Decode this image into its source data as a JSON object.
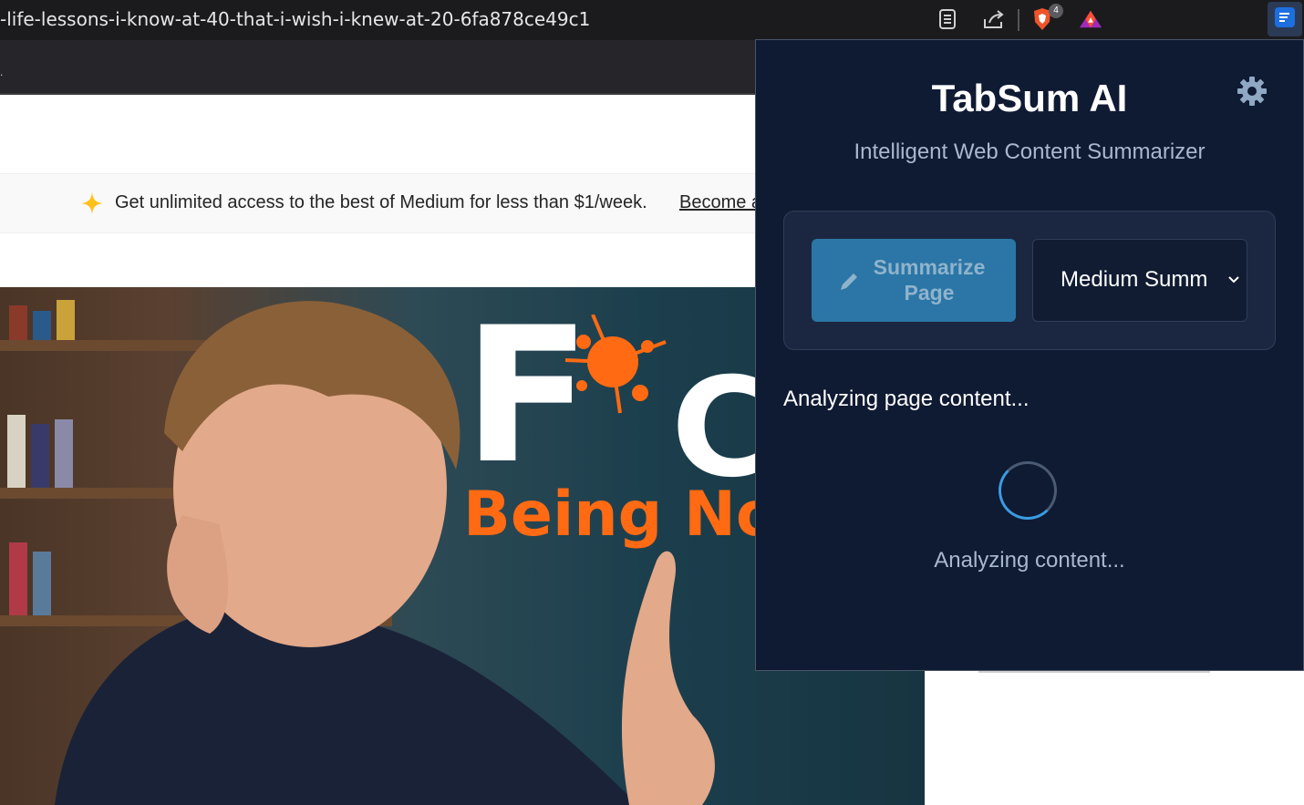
{
  "browser": {
    "url_fragment": "-life-lessons-i-know-at-40-that-i-wish-i-knew-at-20-6fa878ce49c1",
    "brave_badge_count": "4",
    "toolbar_mark": "."
  },
  "page": {
    "banner_text": "Get unlimited access to the best of Medium for less than $1/week.",
    "banner_link": "Become a",
    "hero": {
      "big_letter": "F",
      "big_letter_2": "C",
      "subtitle": "Being No"
    }
  },
  "popup": {
    "title": "TabSum AI",
    "subtitle": "Intelligent Web Content Summarizer",
    "summarize_label": "Summarize Page",
    "mode_value": "Medium Summary",
    "status_text": "Analyzing page content...",
    "loading_text": "Analyzing content...",
    "colors": {
      "background": "#0f1a33",
      "card": "#1b2740",
      "button": "#2b76a6",
      "accent": "#3b9be0"
    }
  },
  "icons": [
    "reader-mode-icon",
    "share-icon",
    "brave-shields-icon",
    "brave-rewards-icon",
    "tabsum-extension-icon",
    "settings-gear-icon",
    "pencil-icon",
    "chevron-down-icon",
    "sparkle-icon"
  ]
}
